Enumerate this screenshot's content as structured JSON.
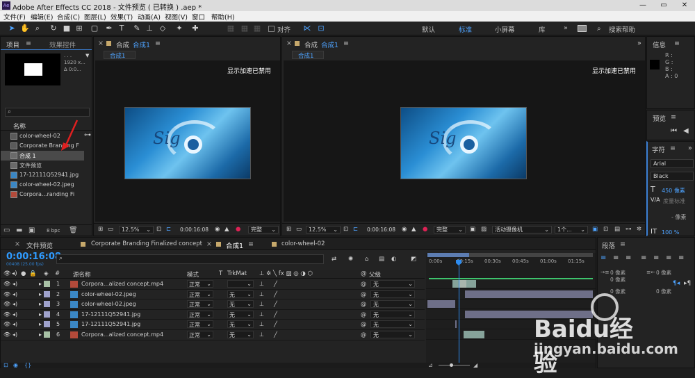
{
  "title": "Adobe After Effects CC 2018 - 文件预览 ( 已转换 ) .aep *",
  "app_icon": "Ae",
  "menu": [
    "文件(F)",
    "编辑(E)",
    "合成(C)",
    "图层(L)",
    "效果(T)",
    "动画(A)",
    "视图(V)",
    "窗口",
    "帮助(H)"
  ],
  "toolbar": {
    "align_label": "对齐",
    "workspaces": [
      "默认",
      "标准",
      "小屏幕",
      "库"
    ],
    "search_label": "搜索帮助"
  },
  "project": {
    "tab_label": "项目",
    "effects_tab": "效果控件",
    "thumb_info": [
      ". . .",
      "1920 x...",
      "∆ 0:0..."
    ],
    "search_placeholder": "",
    "name_header": "名称",
    "items": [
      "color-wheel-02",
      "Corporate Branding  F",
      "合成 1",
      "文件预览",
      "17-12111Q52941.jpg",
      "color-wheel-02.jpeg",
      "Corpora...randing  Fi"
    ],
    "bpc": "8 bpc"
  },
  "comp_left": {
    "tab_label": "合成",
    "tab_comp": "合成1",
    "sub_tab": "合成1",
    "gpu_msg": "显示加速已禁用",
    "zoom": "12.5%",
    "time": "0:00:16:08",
    "quality": "完整"
  },
  "comp_right": {
    "tab_label": "合成",
    "tab_comp": "合成1",
    "sub_tab": "合成1",
    "gpu_msg": "显示加速已禁用",
    "zoom": "12.5%",
    "time": "0:00:16:08",
    "quality": "完整",
    "camera": "活动摄像机",
    "views": "1个..."
  },
  "info": {
    "tab": "信息",
    "r": "R :",
    "g": "G :",
    "b": "B :",
    "a": "A : 0"
  },
  "preview": {
    "tab": "预览"
  },
  "character": {
    "tab": "字符",
    "font": "Arial",
    "style": "Black",
    "size": "450 像素",
    "tracking_label": "度量标准",
    "leading": "- 像素",
    "scale": "100 %"
  },
  "paragraph": {
    "tab": "段落",
    "v1": "0 像素",
    "v2": "0 像素",
    "v3": "0 像素",
    "v4": "0 像素",
    "v5": "0 像素"
  },
  "timeline": {
    "tabs": [
      "文件预览",
      "Corporate Branding  Finalized concept",
      "合成1",
      "color-wheel-02"
    ],
    "active_tab": "合成1",
    "timecode": "0:00:16:08",
    "timecode_sub": "00408 (25.00 fps)",
    "search_placeholder": "",
    "cols": {
      "name": "源名称",
      "mode": "模式",
      "t": "T",
      "trkmat": "TrkMat",
      "parent": "父级"
    },
    "ruler": [
      "0:00s",
      "00:15s",
      "00:30s",
      "00:45s",
      "01:00s",
      "01:15s"
    ],
    "layers": [
      {
        "num": "1",
        "name": "Corpora...alized concept.mp4",
        "mode": "正常",
        "trkmat": "",
        "parent": "无",
        "color": "#a8c1a5"
      },
      {
        "num": "2",
        "name": "color-wheel-02.jpeg",
        "mode": "正常",
        "trkmat": "无",
        "parent": "无",
        "color": "#9fa2cc"
      },
      {
        "num": "3",
        "name": "color-wheel-02.jpeg",
        "mode": "正常",
        "trkmat": "无",
        "parent": "无",
        "color": "#9fa2cc"
      },
      {
        "num": "4",
        "name": "17-12111Q52941.jpg",
        "mode": "正常",
        "trkmat": "无",
        "parent": "无",
        "color": "#9fa2cc"
      },
      {
        "num": "5",
        "name": "17-12111Q52941.jpg",
        "mode": "正常",
        "trkmat": "无",
        "parent": "无",
        "color": "#9fa2cc"
      },
      {
        "num": "6",
        "name": "Corpora...alized concept.mp4",
        "mode": "正常",
        "trkmat": "无",
        "parent": "无",
        "color": "#a8c1a5"
      }
    ]
  },
  "watermark": {
    "brand": "Baidu经验",
    "url": "jingyan.baidu.com"
  },
  "colors": {
    "accent": "#2d8cf0",
    "timecode": "#2f9bff",
    "annotation": "#e02020"
  }
}
